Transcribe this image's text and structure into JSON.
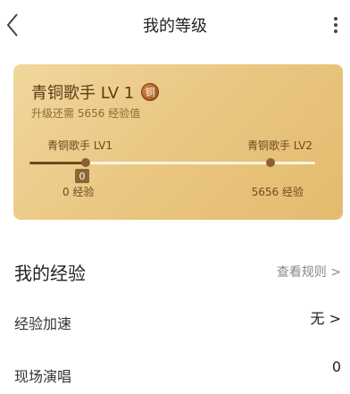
{
  "header": {
    "title": "我的等级",
    "back_icon": "chevron-left-icon",
    "more_icon": "vertical-dots-icon"
  },
  "level_card": {
    "title": "青铜歌手 LV 1",
    "badge_text": "铜",
    "upgrade_hint": "升级还需 5656 经验值",
    "current_level_label": "青铜歌手 LV1",
    "next_level_label": "青铜歌手 LV2",
    "current_exp_tag": "0",
    "current_exp_label": "0 经验",
    "next_exp_label": "5656 经验",
    "progress": 0,
    "colors": {
      "card_gradient_start": "#f1d69d",
      "card_gradient_end": "#e4bb6f",
      "text_dark": "#5b3d16",
      "text_muted": "#8e6a32"
    }
  },
  "experience": {
    "title": "我的经验",
    "rules_link": "查看规则 >",
    "rows": [
      {
        "label": "经验加速",
        "value": "无 >"
      },
      {
        "label": "现场演唱",
        "value": "0"
      }
    ]
  }
}
